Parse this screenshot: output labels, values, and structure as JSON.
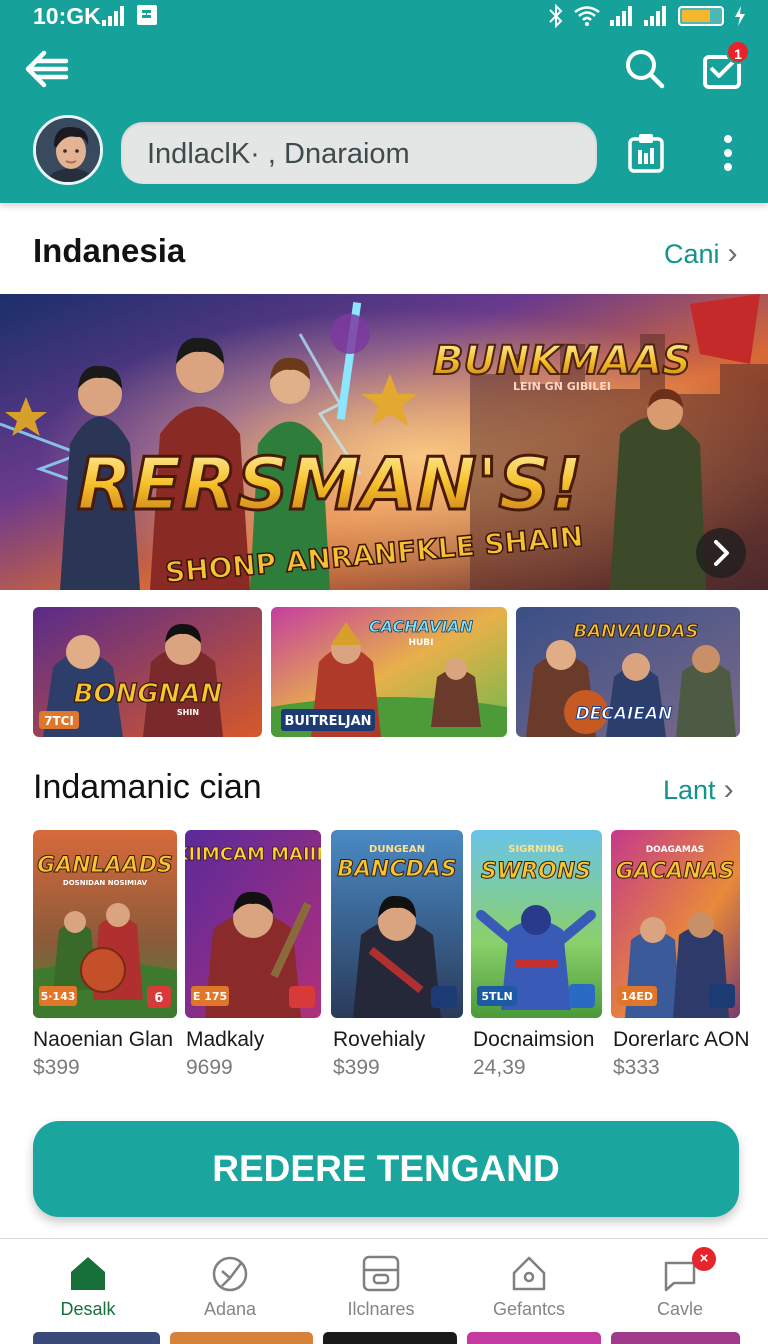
{
  "status_bar": {
    "time": "10:GK"
  },
  "header": {
    "search_text": "IndlaclK· , Dnaraiom",
    "inbox_badge": "1"
  },
  "section1": {
    "title": "Indanesia",
    "link": "Cani"
  },
  "hero": {
    "logo_text": "BUNKMAAS",
    "logo_sub": "LEIN GN GIBILEI",
    "title": "RERSMAN'S!",
    "subtitle": "SHONP ANRANFKLE SHAIN"
  },
  "thumbs": [
    {
      "art_title": "BONGNAN",
      "art_sub": "SHIN",
      "label": "7TCI"
    },
    {
      "art_title": "CACHAVIAN",
      "art_sub": "HUBI",
      "label": "BUITRELJAN"
    },
    {
      "art_title": "BANVAUDAS",
      "art_sub": "",
      "label": "DECAIEAN"
    }
  ],
  "section2": {
    "title": "Indamanic cian",
    "link": "Lant"
  },
  "cards": [
    {
      "art_title": "GANLAADS",
      "art_sub": "DOSNIDAN NOSIMIAV",
      "tag": "5·143",
      "name": "Naoenian Glan",
      "price": "$399"
    },
    {
      "art_title": "KIIMCAM MAIIN",
      "art_sub": "",
      "tag": "E 175",
      "name": "Madkaly",
      "price": "9699"
    },
    {
      "art_title": "BANCDAS",
      "art_sub": "DUNGEAN",
      "tag": "",
      "name": "Rovehialy",
      "price": "$399"
    },
    {
      "art_title": "SWRONS",
      "art_sub": "SIGRNING",
      "tag": "5TLN",
      "name": "Docnaimsion",
      "price": "24,39"
    },
    {
      "art_title": "GACANAS",
      "art_sub": "DOAGAMAS",
      "tag": "14ED",
      "name": "Dorerlarc AON",
      "price": "$333"
    }
  ],
  "cta": {
    "label": "REDERE TENGAND"
  },
  "bottom_nav": [
    {
      "label": "Desalk",
      "icon": "home-icon",
      "active": true
    },
    {
      "label": "Adana",
      "icon": "compass-icon",
      "active": false
    },
    {
      "label": "Ilclnares",
      "icon": "library-icon",
      "active": false
    },
    {
      "label": "Gefantcs",
      "icon": "shop-icon",
      "active": false
    },
    {
      "label": "Cavle",
      "icon": "chat-icon",
      "active": false,
      "badge": "×"
    }
  ],
  "colors": {
    "header": "#16a19b",
    "accent": "#13938d",
    "cta": "#1ba59f",
    "badge": "#e5252a",
    "nav_active": "#176f3a"
  }
}
